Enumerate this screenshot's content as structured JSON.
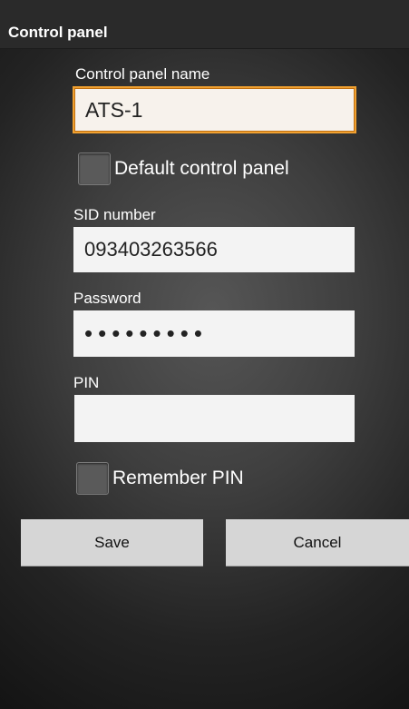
{
  "window": {
    "title": "Control panel"
  },
  "form": {
    "name_label": "Control panel name",
    "name_value": "ATS-1",
    "default_checkbox_label": "Default control panel",
    "default_checked": false,
    "sid_label": "SID number",
    "sid_value": "093403263566",
    "password_label": "Password",
    "password_value": "•••••••••",
    "pin_label": "PIN",
    "pin_value": "",
    "remember_pin_label": "Remember PIN",
    "remember_pin_checked": false
  },
  "buttons": {
    "save_label": "Save",
    "cancel_label": "Cancel"
  },
  "colors": {
    "focus_accent": "#f0a030",
    "titlebar_bg": "#2a2a2a",
    "button_bg": "#d6d6d6"
  }
}
